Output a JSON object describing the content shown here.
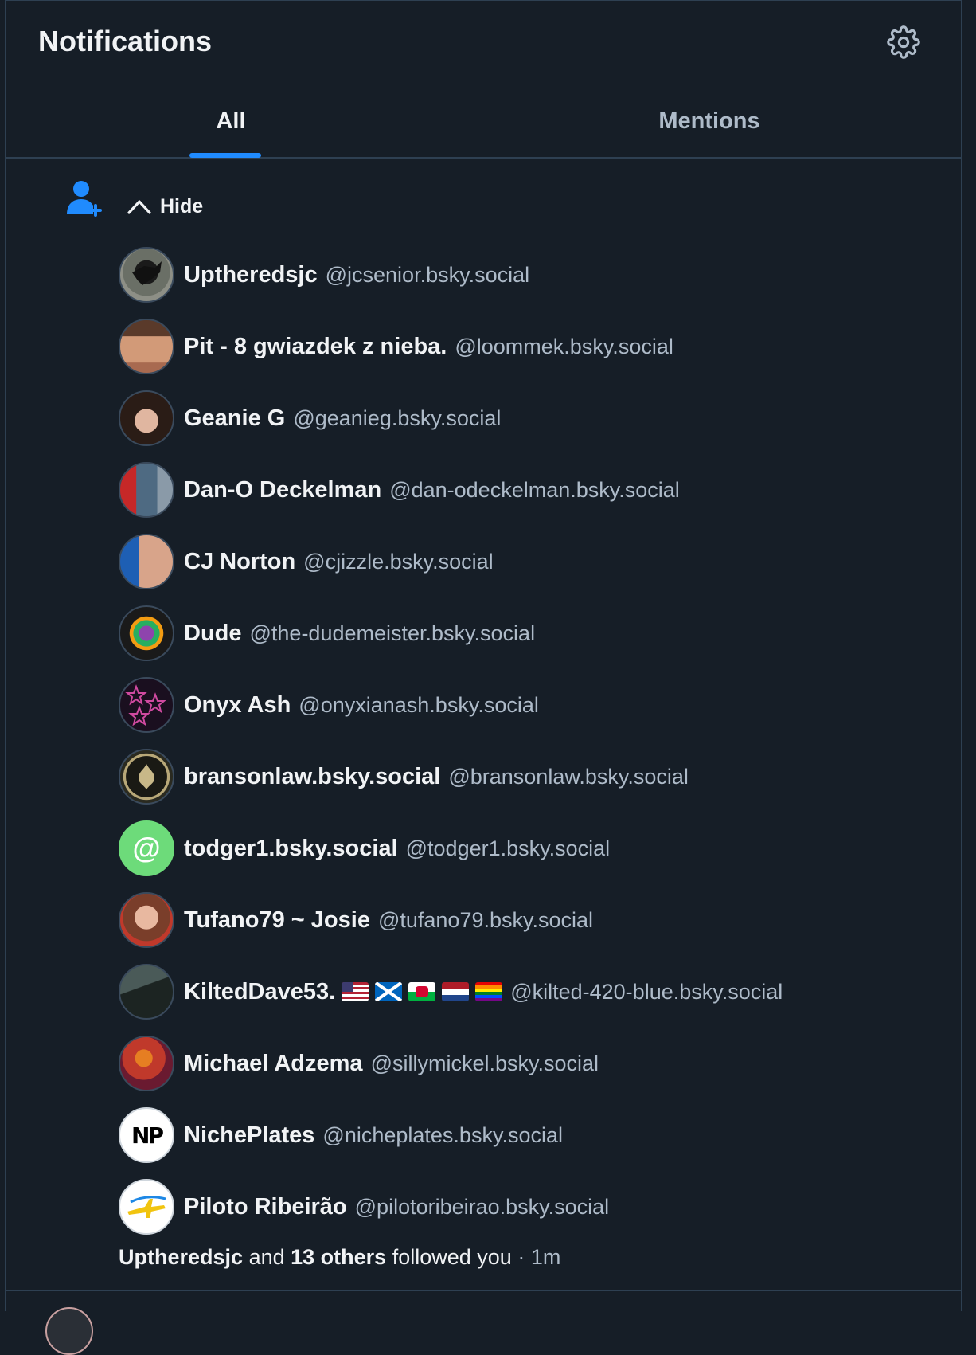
{
  "header": {
    "title": "Notifications",
    "settings_icon": "gear-icon"
  },
  "tabs": [
    {
      "label": "All",
      "active": true
    },
    {
      "label": "Mentions",
      "active": false
    }
  ],
  "colors": {
    "background": "#161e27",
    "accent": "#208bfe",
    "text": "#f1f3f5",
    "muted": "#aebbc9",
    "border": "#2e4052"
  },
  "notification": {
    "type_icon": "person-add-icon",
    "toggle_label": "Hide",
    "toggle_icon": "chevron-up-icon",
    "users": [
      {
        "name": "Uptheredsjc",
        "handle": "@jcsenior.bsky.social",
        "avatar": "bird-photo-avatar"
      },
      {
        "name": "Pit - 8 gwiazdek z nieba.",
        "handle": "@loommek.bsky.social",
        "avatar": "face-photo-avatar"
      },
      {
        "name": "Geanie G",
        "handle": "@geanieg.bsky.social",
        "avatar": "face-photo-avatar"
      },
      {
        "name": "Dan-O Deckelman",
        "handle": "@dan-odeckelman.bsky.social",
        "avatar": "guitar-photo-avatar"
      },
      {
        "name": "CJ Norton",
        "handle": "@cjizzle.bsky.social",
        "avatar": "face-photo-avatar"
      },
      {
        "name": "Dude",
        "handle": "@the-dudemeister.bsky.social",
        "avatar": "colorful-bear-avatar"
      },
      {
        "name": "Onyx Ash",
        "handle": "@onyxianash.bsky.social",
        "avatar": "stars-avatar"
      },
      {
        "name": "bransonlaw.bsky.social",
        "handle": "@bransonlaw.bsky.social",
        "avatar": "emblem-avatar"
      },
      {
        "name": "todger1.bsky.social",
        "handle": "@todger1.bsky.social",
        "avatar": "default-at-avatar"
      },
      {
        "name": "Tufano79 ~ Josie",
        "handle": "@tufano79.bsky.social",
        "avatar": "face-photo-avatar"
      },
      {
        "name": "KiltedDave53.",
        "handle": "@kilted-420-blue.bsky.social",
        "avatar": "costume-photo-avatar",
        "flags": [
          "us-flag-icon",
          "scotland-flag-icon",
          "wales-flag-icon",
          "netherlands-flag-icon",
          "rainbow-flag-icon"
        ]
      },
      {
        "name": "Michael Adzema",
        "handle": "@sillymickel.bsky.social",
        "avatar": "stage-photo-avatar"
      },
      {
        "name": "NichePlates",
        "handle": "@nicheplates.bsky.social",
        "avatar": "np-logo-avatar",
        "avatar_text": "NP"
      },
      {
        "name": "Piloto Ribeirão",
        "handle": "@pilotoribeirao.bsky.social",
        "avatar": "piloto-logo-avatar"
      }
    ],
    "summary": {
      "first": "Uptheredsjc",
      "and": "and",
      "others": "13 others",
      "action": "followed you",
      "separator": "·",
      "time": "1m"
    }
  }
}
